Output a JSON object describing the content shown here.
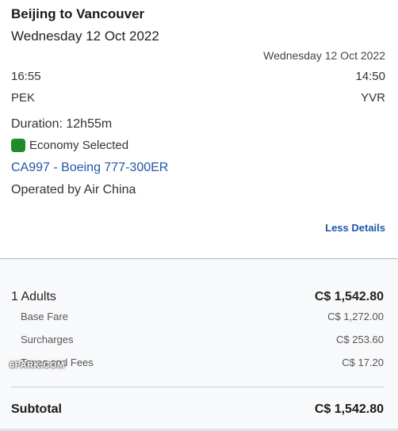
{
  "flight": {
    "route_title": "Beijing to Vancouver",
    "departure_date": "Wednesday 12 Oct 2022",
    "arrival_date": "Wednesday 12 Oct 2022",
    "departure_time": "16:55",
    "arrival_time": "14:50",
    "departure_code": "PEK",
    "arrival_code": "YVR",
    "duration": "Duration: 12h55m",
    "cabin": "Economy Selected",
    "cabin_color": "#1f8c2a",
    "flight_info": "CA997 - Boeing 777-300ER",
    "operated_by": "Operated by Air China",
    "less_details": "Less Details"
  },
  "pricing": {
    "adults_label": "1 Adults",
    "adults_amount": "C$ 1,542.80",
    "base_fare_label": "Base Fare",
    "base_fare_amount": "C$ 1,272.00",
    "surcharges_label": "Surcharges",
    "surcharges_amount": "C$ 253.60",
    "taxes_label": "Taxes and Fees",
    "taxes_amount": "C$ 17.20",
    "subtotal_label": "Subtotal",
    "subtotal_amount": "C$ 1,542.80"
  },
  "watermark": "6PARK.COM",
  "colors": {
    "link": "#1f57a8",
    "divider": "#aeb8c7"
  }
}
